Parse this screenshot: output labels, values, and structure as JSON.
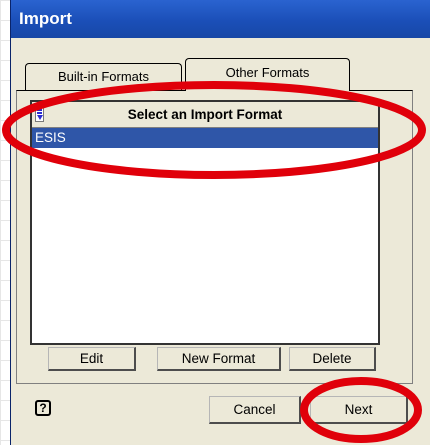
{
  "dialog": {
    "title": "Import"
  },
  "tabs": [
    {
      "label": "Built-in Formats",
      "selected": false
    },
    {
      "label": "Other Formats",
      "selected": true
    }
  ],
  "list": {
    "header": "Select an Import Format",
    "sort_icon": "sort-descending-icon",
    "items": [
      {
        "label": "ESIS",
        "selected": true
      }
    ]
  },
  "list_buttons": {
    "edit": "Edit",
    "new_format": "New Format",
    "delete": "Delete"
  },
  "footer": {
    "help_glyph": "?",
    "cancel": "Cancel",
    "next": "Next"
  },
  "colors": {
    "titlebar": "#1b4fb8",
    "selection": "#2f56a8",
    "dialog_bg": "#ece9d8",
    "annotation": "#e0000a"
  }
}
